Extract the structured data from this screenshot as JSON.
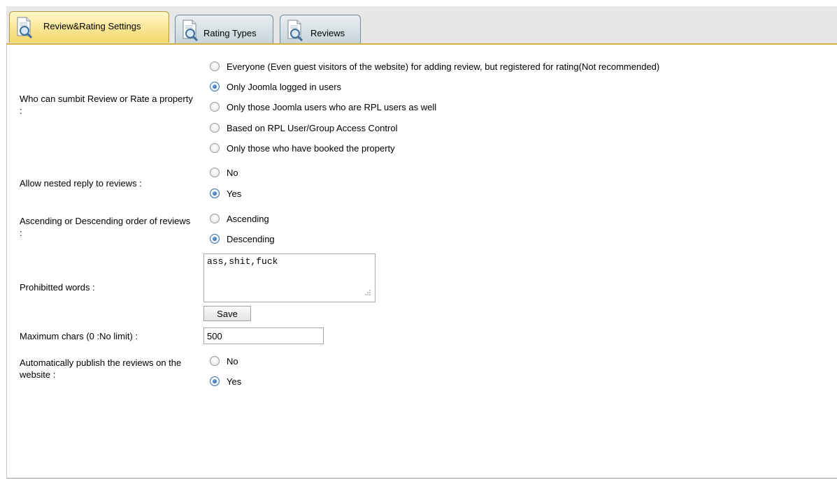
{
  "tabs": [
    {
      "label": "Review&Rating Settings",
      "icon": "document-magnifier-icon",
      "active": true
    },
    {
      "label": "Rating Types",
      "icon": "document-magnifier-icon",
      "active": false
    },
    {
      "label": "Reviews",
      "icon": "document-magnifier-icon",
      "active": false
    }
  ],
  "settings": {
    "who_can_submit": {
      "label": "Who can sumbit Review or Rate a property :",
      "options": [
        "Everyone (Even guest visitors of the website) for adding review, but registered for rating(Not recommended)",
        "Only Joomla logged in users",
        "Only those Joomla users who are RPL users as well",
        "Based on RPL User/Group Access Control",
        "Only those who have booked the property"
      ],
      "selected": "Only Joomla logged in users"
    },
    "nested_reply": {
      "label": "Allow nested reply to reviews :",
      "options": [
        "No",
        "Yes"
      ],
      "selected": "Yes"
    },
    "order": {
      "label": "Ascending or Descending order of reviews :",
      "options": [
        "Ascending",
        "Descending"
      ],
      "selected": "Descending"
    },
    "prohibited_words": {
      "label": "Prohibitted words :",
      "value": "ass,shit,fuck",
      "save_label": "Save"
    },
    "max_chars": {
      "label": "Maximum chars (0 :No limit) :",
      "value": "500"
    },
    "auto_publish": {
      "label": "Automatically publish the reviews on the website :",
      "options": [
        "No",
        "Yes"
      ],
      "selected": "Yes"
    }
  },
  "colors": {
    "active_tab": "#f4d66a",
    "inactive_tab": "#c8d5db",
    "radio_selected": "#1f4f8a"
  }
}
